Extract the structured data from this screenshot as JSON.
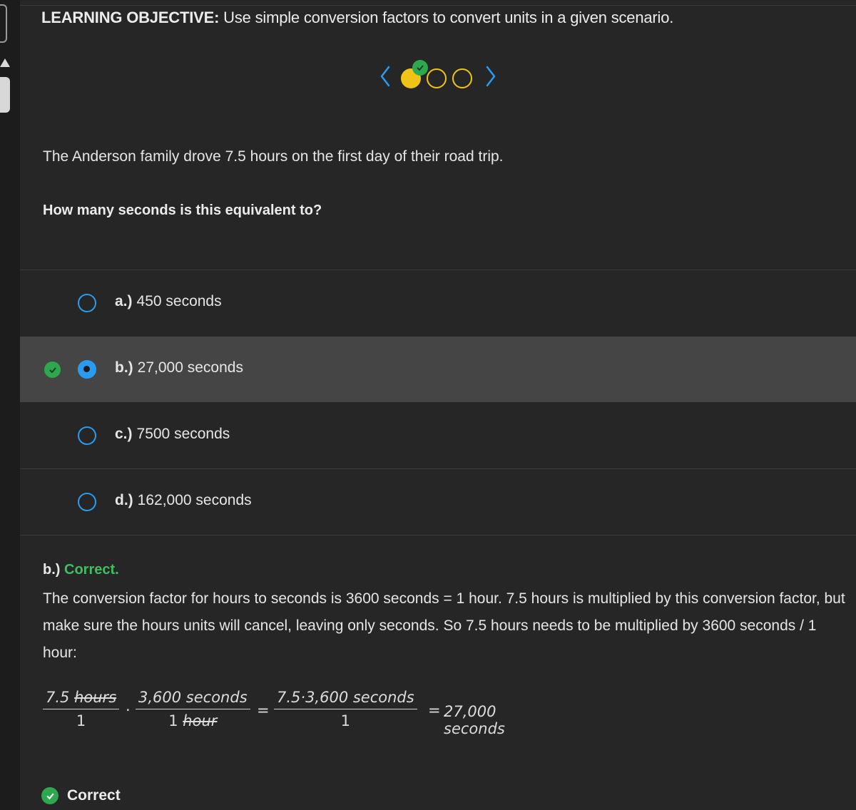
{
  "objective": {
    "label": "LEARNING OBJECTIVE:",
    "text": "Use simple conversion factors to convert units in a given scenario."
  },
  "colors": {
    "accent_blue": "#2a9bf0",
    "progress_yellow": "#f0c417",
    "correct_green": "#3fbf5f",
    "background": "#262626",
    "selected_row": "#454545"
  },
  "pager": {
    "prev_icon": "chevron-left-icon",
    "next_icon": "chevron-right-icon",
    "total": 3,
    "current": 1,
    "completed": [
      1
    ]
  },
  "scenario": "The Anderson family drove 7.5 hours on the first day of their road trip.",
  "question": "How many seconds is this equivalent to?",
  "choices": [
    {
      "letter": "a.)",
      "text": "450 seconds",
      "selected": false,
      "correct": false
    },
    {
      "letter": "b.)",
      "text": "27,000 seconds",
      "selected": true,
      "correct": true
    },
    {
      "letter": "c.)",
      "text": "7500 seconds",
      "selected": false,
      "correct": false
    },
    {
      "letter": "d.)",
      "text": "162,000 seconds",
      "selected": false,
      "correct": false
    }
  ],
  "feedback": {
    "letter": "b.)",
    "status": "Correct.",
    "body": "The conversion factor for hours to seconds is 3600 seconds = 1 hour. 7.5 hours is multiplied by this conversion factor, but make sure the hours units will cancel, leaving only seconds. So 7.5 hours needs to be multiplied by 3600 seconds / 1 hour:"
  },
  "math": {
    "f1_num_value": "7.5",
    "f1_num_unit": "hours",
    "f1_den": "1",
    "dot1": "·",
    "f2_num": "3,600 seconds",
    "f2_den_value": "1",
    "f2_den_unit": "hour",
    "eq1": "=",
    "f3_num": "7.5·3,600 seconds",
    "f3_den": "1",
    "eq2": "=",
    "result": "27,000 seconds"
  },
  "result": {
    "icon": "check-circle-icon",
    "text": "Correct"
  }
}
